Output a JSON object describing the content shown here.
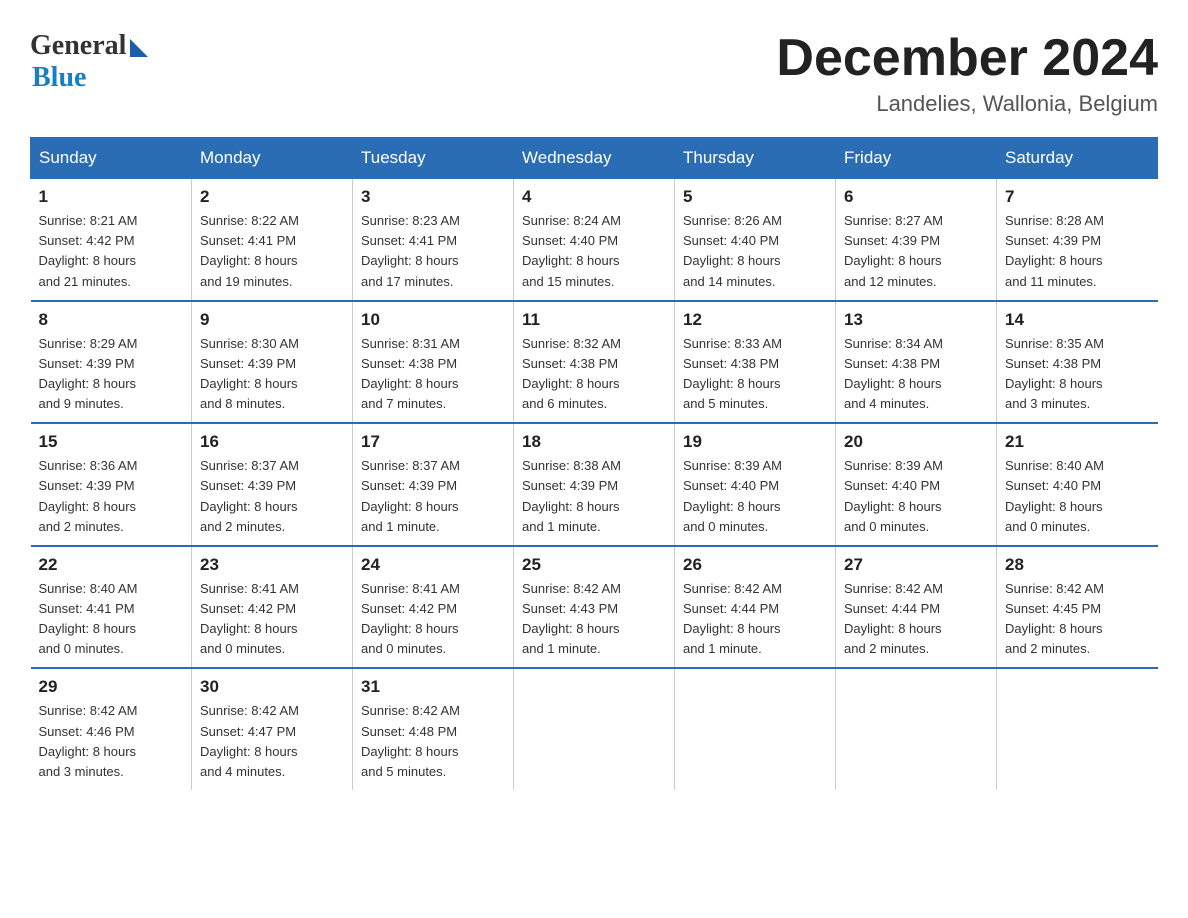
{
  "header": {
    "logo_general": "General",
    "logo_blue": "Blue",
    "month_title": "December 2024",
    "location": "Landelies, Wallonia, Belgium"
  },
  "days_of_week": [
    "Sunday",
    "Monday",
    "Tuesday",
    "Wednesday",
    "Thursday",
    "Friday",
    "Saturday"
  ],
  "weeks": [
    [
      {
        "day": "1",
        "sunrise": "8:21 AM",
        "sunset": "4:42 PM",
        "daylight": "8 hours and 21 minutes."
      },
      {
        "day": "2",
        "sunrise": "8:22 AM",
        "sunset": "4:41 PM",
        "daylight": "8 hours and 19 minutes."
      },
      {
        "day": "3",
        "sunrise": "8:23 AM",
        "sunset": "4:41 PM",
        "daylight": "8 hours and 17 minutes."
      },
      {
        "day": "4",
        "sunrise": "8:24 AM",
        "sunset": "4:40 PM",
        "daylight": "8 hours and 15 minutes."
      },
      {
        "day": "5",
        "sunrise": "8:26 AM",
        "sunset": "4:40 PM",
        "daylight": "8 hours and 14 minutes."
      },
      {
        "day": "6",
        "sunrise": "8:27 AM",
        "sunset": "4:39 PM",
        "daylight": "8 hours and 12 minutes."
      },
      {
        "day": "7",
        "sunrise": "8:28 AM",
        "sunset": "4:39 PM",
        "daylight": "8 hours and 11 minutes."
      }
    ],
    [
      {
        "day": "8",
        "sunrise": "8:29 AM",
        "sunset": "4:39 PM",
        "daylight": "8 hours and 9 minutes."
      },
      {
        "day": "9",
        "sunrise": "8:30 AM",
        "sunset": "4:39 PM",
        "daylight": "8 hours and 8 minutes."
      },
      {
        "day": "10",
        "sunrise": "8:31 AM",
        "sunset": "4:38 PM",
        "daylight": "8 hours and 7 minutes."
      },
      {
        "day": "11",
        "sunrise": "8:32 AM",
        "sunset": "4:38 PM",
        "daylight": "8 hours and 6 minutes."
      },
      {
        "day": "12",
        "sunrise": "8:33 AM",
        "sunset": "4:38 PM",
        "daylight": "8 hours and 5 minutes."
      },
      {
        "day": "13",
        "sunrise": "8:34 AM",
        "sunset": "4:38 PM",
        "daylight": "8 hours and 4 minutes."
      },
      {
        "day": "14",
        "sunrise": "8:35 AM",
        "sunset": "4:38 PM",
        "daylight": "8 hours and 3 minutes."
      }
    ],
    [
      {
        "day": "15",
        "sunrise": "8:36 AM",
        "sunset": "4:39 PM",
        "daylight": "8 hours and 2 minutes."
      },
      {
        "day": "16",
        "sunrise": "8:37 AM",
        "sunset": "4:39 PM",
        "daylight": "8 hours and 2 minutes."
      },
      {
        "day": "17",
        "sunrise": "8:37 AM",
        "sunset": "4:39 PM",
        "daylight": "8 hours and 1 minute."
      },
      {
        "day": "18",
        "sunrise": "8:38 AM",
        "sunset": "4:39 PM",
        "daylight": "8 hours and 1 minute."
      },
      {
        "day": "19",
        "sunrise": "8:39 AM",
        "sunset": "4:40 PM",
        "daylight": "8 hours and 0 minutes."
      },
      {
        "day": "20",
        "sunrise": "8:39 AM",
        "sunset": "4:40 PM",
        "daylight": "8 hours and 0 minutes."
      },
      {
        "day": "21",
        "sunrise": "8:40 AM",
        "sunset": "4:40 PM",
        "daylight": "8 hours and 0 minutes."
      }
    ],
    [
      {
        "day": "22",
        "sunrise": "8:40 AM",
        "sunset": "4:41 PM",
        "daylight": "8 hours and 0 minutes."
      },
      {
        "day": "23",
        "sunrise": "8:41 AM",
        "sunset": "4:42 PM",
        "daylight": "8 hours and 0 minutes."
      },
      {
        "day": "24",
        "sunrise": "8:41 AM",
        "sunset": "4:42 PM",
        "daylight": "8 hours and 0 minutes."
      },
      {
        "day": "25",
        "sunrise": "8:42 AM",
        "sunset": "4:43 PM",
        "daylight": "8 hours and 1 minute."
      },
      {
        "day": "26",
        "sunrise": "8:42 AM",
        "sunset": "4:44 PM",
        "daylight": "8 hours and 1 minute."
      },
      {
        "day": "27",
        "sunrise": "8:42 AM",
        "sunset": "4:44 PM",
        "daylight": "8 hours and 2 minutes."
      },
      {
        "day": "28",
        "sunrise": "8:42 AM",
        "sunset": "4:45 PM",
        "daylight": "8 hours and 2 minutes."
      }
    ],
    [
      {
        "day": "29",
        "sunrise": "8:42 AM",
        "sunset": "4:46 PM",
        "daylight": "8 hours and 3 minutes."
      },
      {
        "day": "30",
        "sunrise": "8:42 AM",
        "sunset": "4:47 PM",
        "daylight": "8 hours and 4 minutes."
      },
      {
        "day": "31",
        "sunrise": "8:42 AM",
        "sunset": "4:48 PM",
        "daylight": "8 hours and 5 minutes."
      },
      null,
      null,
      null,
      null
    ]
  ],
  "labels": {
    "sunrise": "Sunrise:",
    "sunset": "Sunset:",
    "daylight": "Daylight:"
  }
}
